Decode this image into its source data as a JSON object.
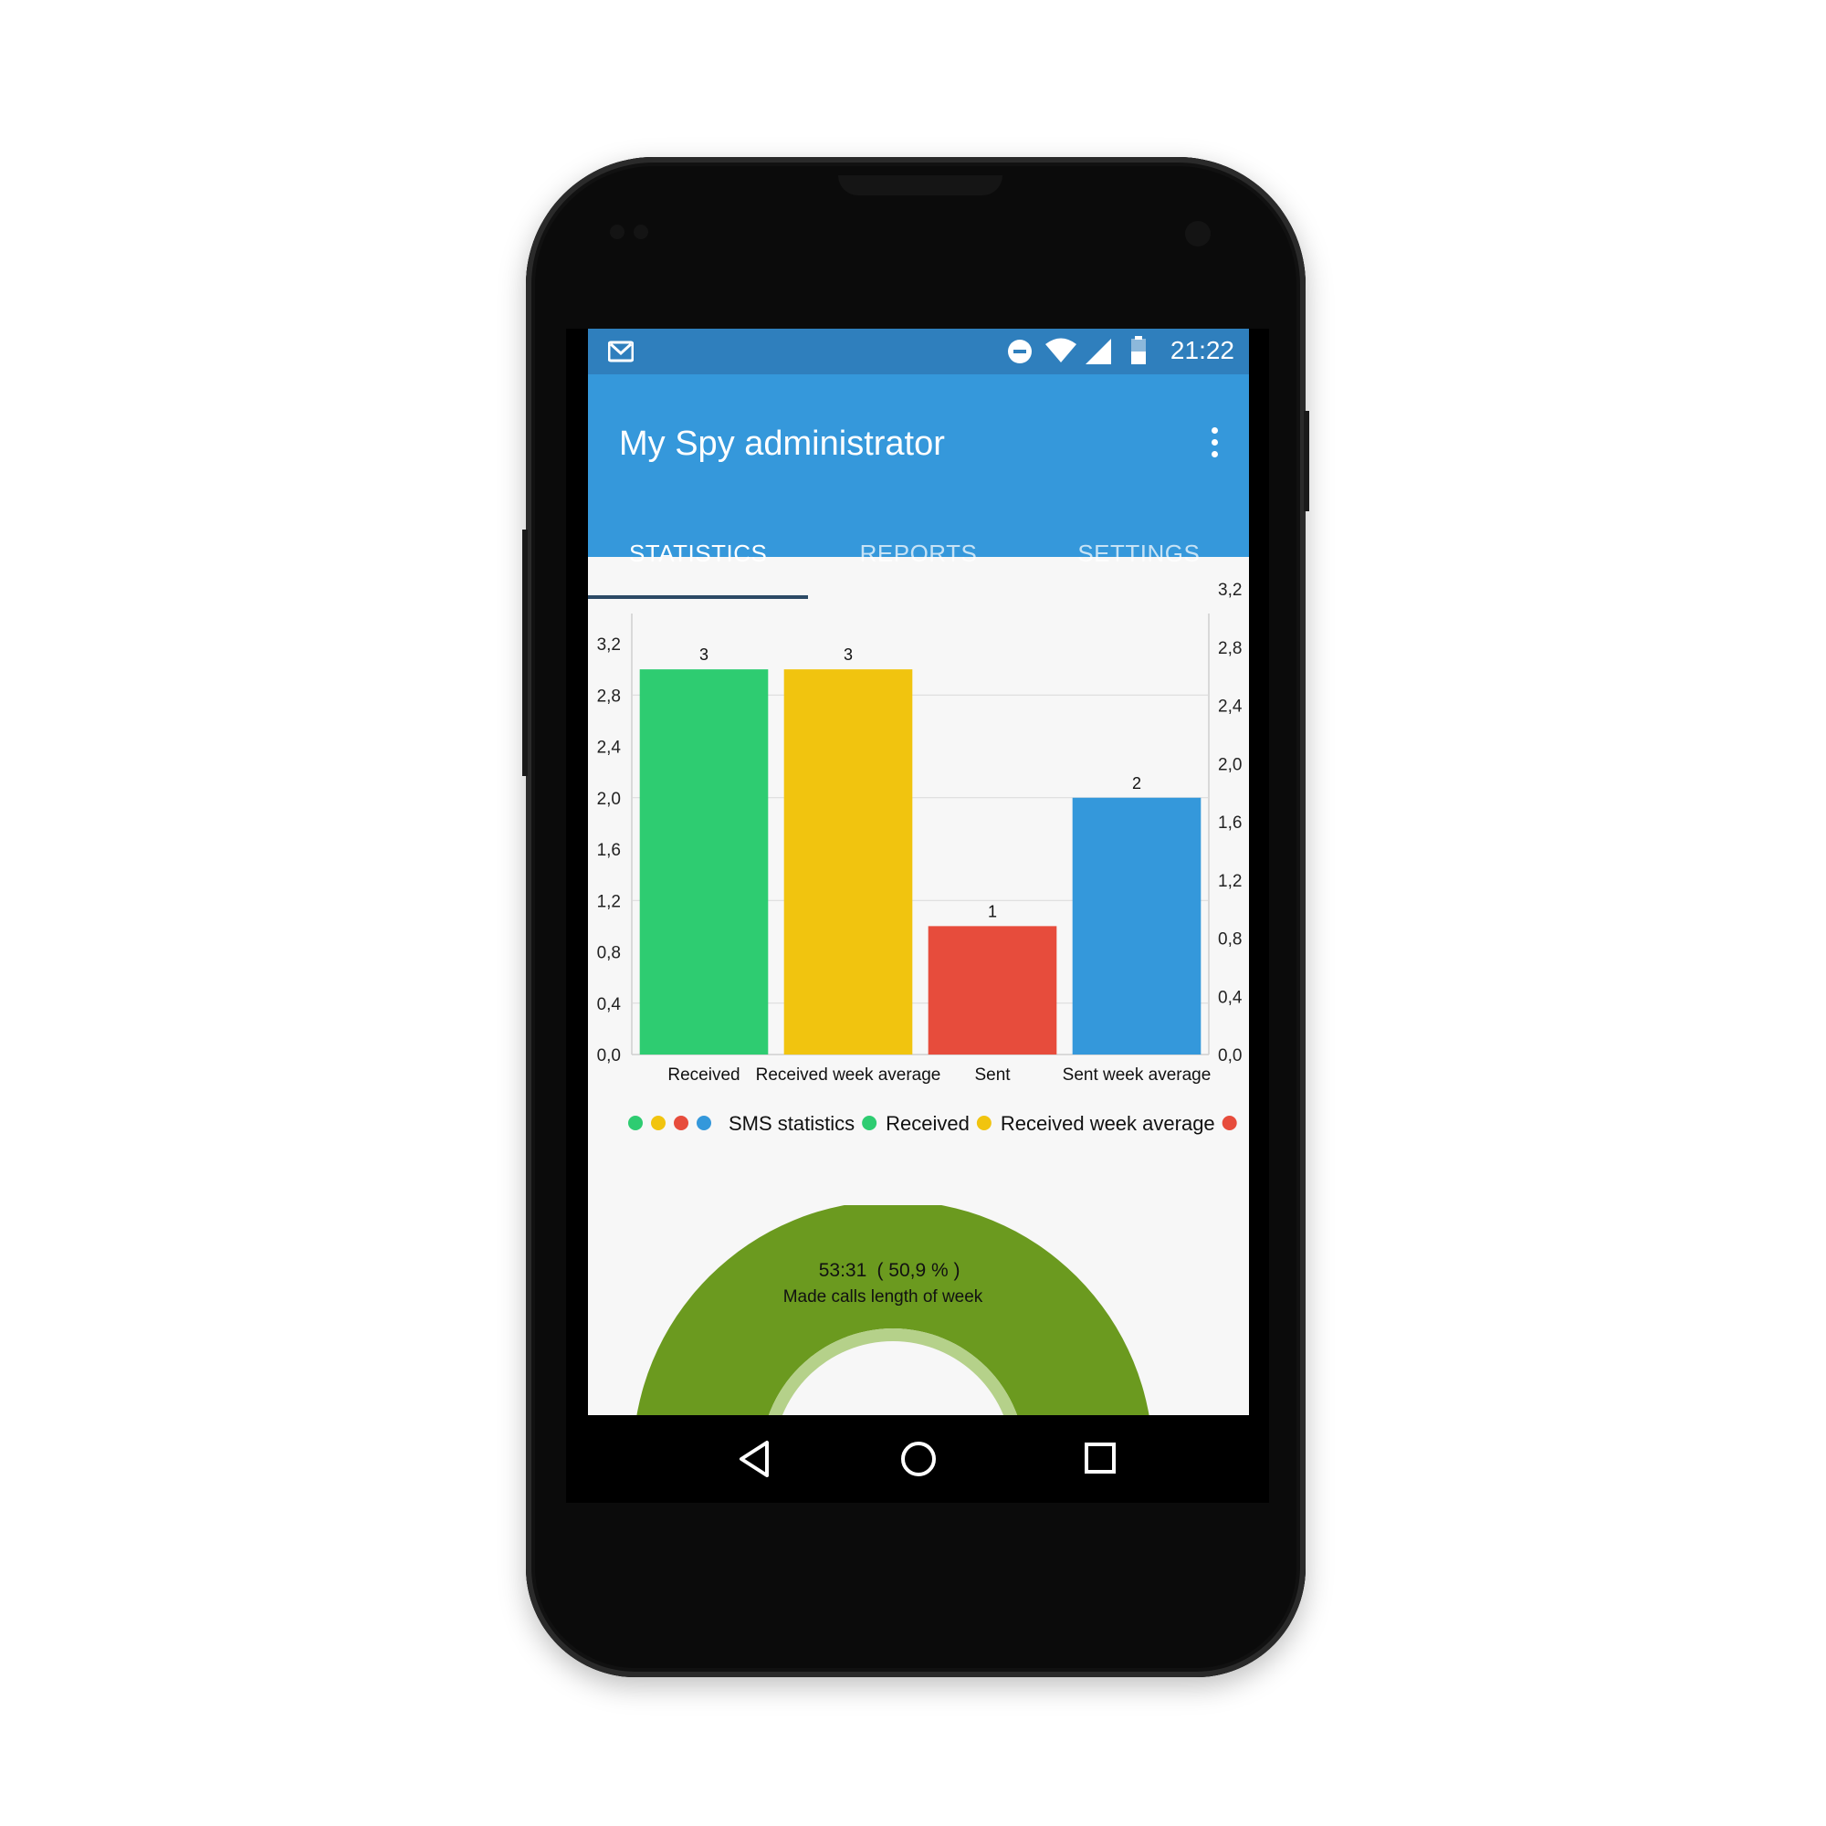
{
  "status_bar": {
    "time": "21:22",
    "icons": [
      "gmail-icon",
      "do-not-disturb-icon",
      "wifi-icon",
      "signal-icon",
      "battery-icon"
    ]
  },
  "app": {
    "title": "My Spy administrator",
    "menu_icon": "more-vert-icon"
  },
  "tabs": [
    {
      "label": "STATISTICS",
      "active": true
    },
    {
      "label": "REPORTS",
      "active": false
    },
    {
      "label": "SETTINGS",
      "active": false
    }
  ],
  "chart_data": [
    {
      "type": "bar",
      "title": "",
      "categories": [
        "Received",
        "Received week average",
        "Sent",
        "Sent week average"
      ],
      "values": [
        3,
        3,
        1,
        2
      ],
      "value_labels": [
        "3",
        "3",
        "1",
        "2"
      ],
      "colors": [
        "#2ecc71",
        "#f1c40f",
        "#e74c3c",
        "#3498db"
      ],
      "ylim": [
        0,
        3.2
      ],
      "y_ticks_left": [
        "0,0",
        "0,4",
        "0,8",
        "1,2",
        "1,6",
        "2,0",
        "2,4",
        "2,8",
        "3,2"
      ],
      "y_ticks_right": [
        "0,0",
        "0,4",
        "0,8",
        "1,2",
        "1,6",
        "2,0",
        "2,4",
        "2,8",
        "3,2"
      ],
      "grid": true,
      "legend": {
        "placement": "bottom",
        "dataset_label": "SMS statistics",
        "dataset_colors": [
          "#2ecc71",
          "#f1c40f",
          "#e74c3c",
          "#3498db"
        ],
        "entries": [
          {
            "label": "Received",
            "color": "#2ecc71"
          },
          {
            "label": "Received week average",
            "color": "#f1c40f"
          },
          {
            "label": "",
            "color": "#e74c3c"
          }
        ]
      }
    },
    {
      "type": "pie",
      "subtype": "half-donut",
      "value_text": "53:31",
      "percent_text": "( 50,9 % )",
      "caption": "Made calls length of week",
      "values": [
        50.9
      ],
      "colors": [
        "#6b9a1f",
        "#b5d18a"
      ]
    }
  ],
  "nav_bar": {
    "buttons": [
      "back-icon",
      "home-icon",
      "recents-icon"
    ]
  }
}
